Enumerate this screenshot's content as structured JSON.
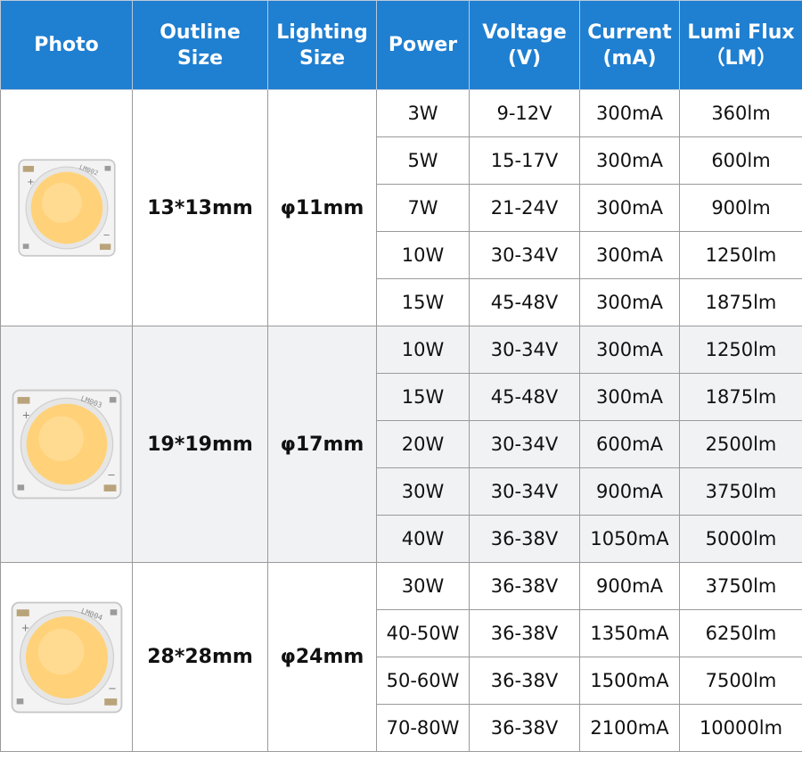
{
  "headers": {
    "photo": "Photo",
    "outline_1": "Outline",
    "outline_2": "Size",
    "lighting_1": "Lighting",
    "lighting_2": "Size",
    "power": "Power",
    "voltage_1": "Voltage",
    "voltage_2": "(V)",
    "current_1": "Current",
    "current_2": "(mA)",
    "flux_1": "Lumi Flux",
    "flux_2": "（LM）"
  },
  "groups": [
    {
      "chip_label": "LM002",
      "outline": "13*13mm",
      "lighting": "φ11mm",
      "rows": [
        {
          "power": "3W",
          "voltage": "9-12V",
          "current": "300mA",
          "flux": "360lm"
        },
        {
          "power": "5W",
          "voltage": "15-17V",
          "current": "300mA",
          "flux": "600lm"
        },
        {
          "power": "7W",
          "voltage": "21-24V",
          "current": "300mA",
          "flux": "900lm"
        },
        {
          "power": "10W",
          "voltage": "30-34V",
          "current": "300mA",
          "flux": "1250lm"
        },
        {
          "power": "15W",
          "voltage": "45-48V",
          "current": "300mA",
          "flux": "1875lm"
        }
      ]
    },
    {
      "chip_label": "LM003",
      "outline": "19*19mm",
      "lighting": "φ17mm",
      "rows": [
        {
          "power": "10W",
          "voltage": "30-34V",
          "current": "300mA",
          "flux": "1250lm"
        },
        {
          "power": "15W",
          "voltage": "45-48V",
          "current": "300mA",
          "flux": "1875lm"
        },
        {
          "power": "20W",
          "voltage": "30-34V",
          "current": "600mA",
          "flux": "2500lm"
        },
        {
          "power": "30W",
          "voltage": "30-34V",
          "current": "900mA",
          "flux": "3750lm"
        },
        {
          "power": "40W",
          "voltage": "36-38V",
          "current": "1050mA",
          "flux": "5000lm"
        }
      ]
    },
    {
      "chip_label": "LM004",
      "outline": "28*28mm",
      "lighting": "φ24mm",
      "rows": [
        {
          "power": "30W",
          "voltage": "36-38V",
          "current": "900mA",
          "flux": "3750lm"
        },
        {
          "power": "40-50W",
          "voltage": "36-38V",
          "current": "1350mA",
          "flux": "6250lm"
        },
        {
          "power": "50-60W",
          "voltage": "36-38V",
          "current": "1500mA",
          "flux": "7500lm"
        },
        {
          "power": "70-80W",
          "voltage": "36-38V",
          "current": "2100mA",
          "flux": "10000lm"
        }
      ]
    }
  ],
  "colors": {
    "header_bg": "#1f7fd1",
    "header_text": "#ffffff",
    "led_yellow": "#ffd27a",
    "substrate": "#f3f3f3",
    "pad_gold": "#b9a37a"
  },
  "icons": [
    "cob-led-chip-icon"
  ]
}
